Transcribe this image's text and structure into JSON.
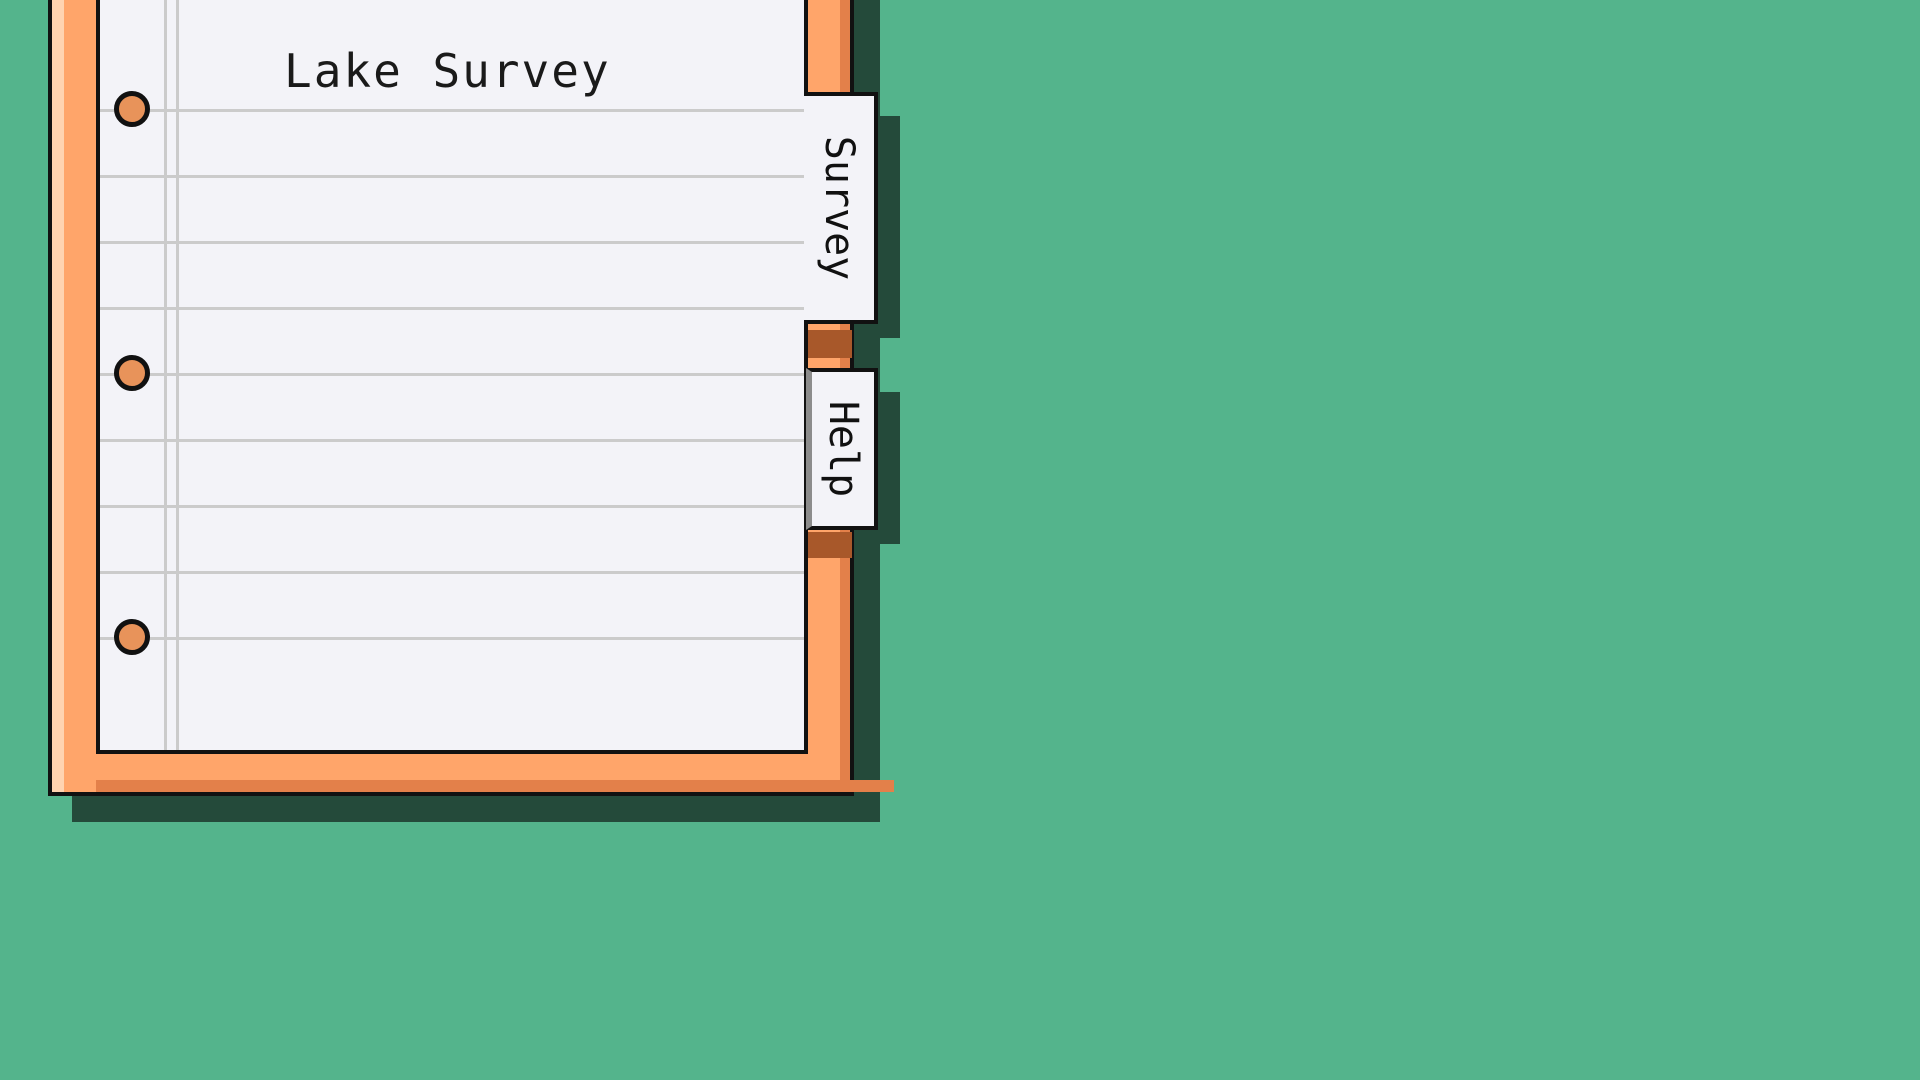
{
  "notebook": {
    "title": "Lake Survey"
  },
  "tabs": [
    {
      "label": "Survey",
      "active": true
    },
    {
      "label": "Help",
      "active": false
    }
  ],
  "colors": {
    "background": "#54b48c",
    "binder": "#ffa56a",
    "paper": "#f3f3f8",
    "outline": "#111111",
    "shadow": "#244a3a"
  }
}
